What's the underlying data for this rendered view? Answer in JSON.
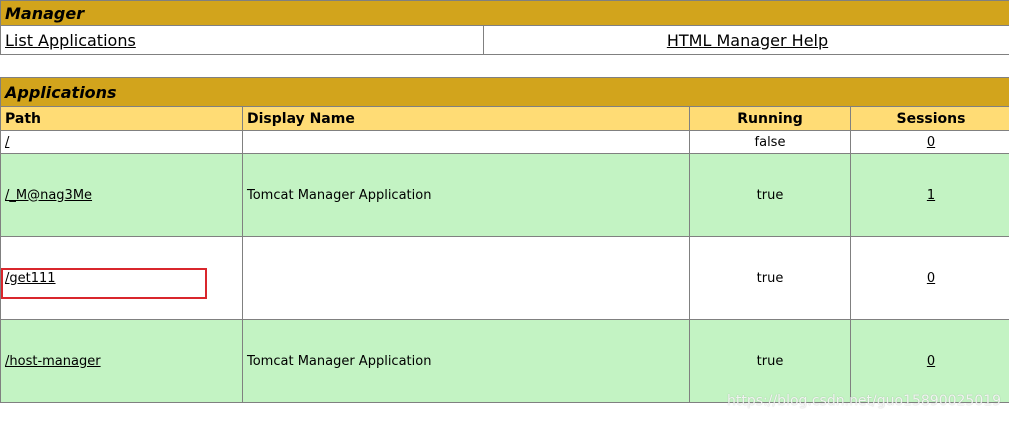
{
  "manager": {
    "title": "Manager",
    "links": {
      "list_applications": "List Applications",
      "help": "HTML Manager Help"
    }
  },
  "applications": {
    "title": "Applications",
    "columns": [
      "Path",
      "Display Name",
      "Running",
      "Sessions"
    ],
    "rows": [
      {
        "path": "/",
        "display_name": "",
        "running": "false",
        "sessions": "0"
      },
      {
        "path": "/_M@nag3Me",
        "display_name": "Tomcat Manager Application",
        "running": "true",
        "sessions": "1"
      },
      {
        "path": "/get111",
        "display_name": "",
        "running": "true",
        "sessions": "0"
      },
      {
        "path": "/host-manager",
        "display_name": "Tomcat Manager Application",
        "running": "true",
        "sessions": "0"
      }
    ]
  },
  "annotation": {
    "highlight_color": "#D9262C"
  },
  "watermark": "https://blog.csdn.net/guo15890025019",
  "colors": {
    "title_bar": "#D2A41C",
    "header_row": "#FFDC75",
    "row_alt": "#C3F3C3"
  }
}
